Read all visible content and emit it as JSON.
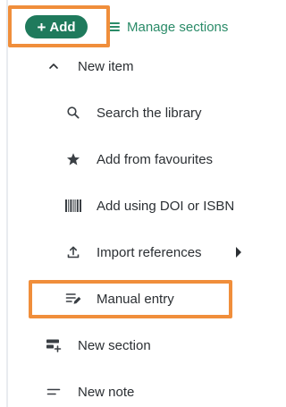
{
  "toolbar": {
    "add_label": "Add",
    "add_icon": "plus-icon",
    "manage_label": "Manage sections",
    "manage_icon": "menu-lines-icon"
  },
  "menu": {
    "new_item": {
      "label": "New item",
      "icon": "chevron-up-icon"
    },
    "sub_items": [
      {
        "label": "Search the library",
        "icon": "search-icon"
      },
      {
        "label": "Add from favourites",
        "icon": "star-icon"
      },
      {
        "label": "Add using DOI or ISBN",
        "icon": "barcode-icon"
      },
      {
        "label": "Import references",
        "icon": "upload-icon",
        "has_submenu": true
      },
      {
        "label": "Manual entry",
        "icon": "edit-list-icon"
      }
    ],
    "new_section": {
      "label": "New section",
      "icon": "add-section-icon"
    },
    "new_note": {
      "label": "New note",
      "icon": "note-lines-icon"
    }
  },
  "colors": {
    "accent_green": "#1f7a5c",
    "link_green": "#2a8b68",
    "highlight_orange": "#f08e3b",
    "text": "#2b2f33"
  }
}
